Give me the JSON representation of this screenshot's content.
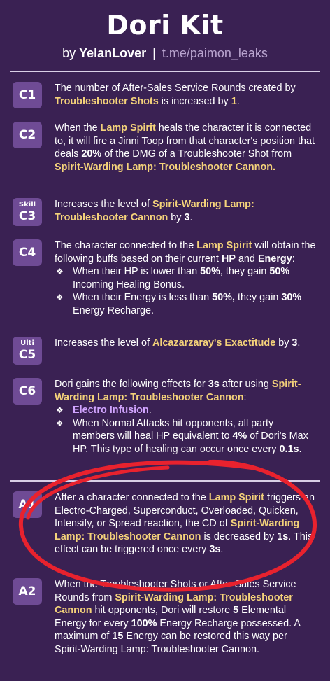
{
  "header": {
    "title": "Dori Kit",
    "by": "by",
    "author": "YelanLover",
    "separator": "|",
    "link": "t.me/paimon_leaks"
  },
  "rows": {
    "c1": {
      "badge": "C1",
      "t1": "The number of After-Sales Service Rounds created by ",
      "h1": "Troubleshooter Shots",
      "t2": " is increased by ",
      "h2": "1",
      "t3": "."
    },
    "c2": {
      "badge": "C2",
      "t1": "When the ",
      "h1": "Lamp Spirit",
      "t2": " heals the character it is connected to, it will fire a Jinni Toop from that character's position that deals ",
      "h2": "20%",
      "t3": " of the DMG of a Troubleshooter Shot from ",
      "h3": "Spirit-Warding Lamp: Troubleshooter Cannon.",
      "t4": ""
    },
    "c3": {
      "badge_small": "Skill",
      "badge": "C3",
      "t1": "Increases the level of ",
      "h1": "Spirit-Warding Lamp: Troubleshooter Cannon",
      "t2": " by ",
      "h2": "3",
      "t3": "."
    },
    "c4": {
      "badge": "C4",
      "t1": "The character connected to the ",
      "h1": "Lamp Spirit",
      "t2": " will obtain the following buffs based on their current ",
      "h2": "HP",
      "t3": " and ",
      "h3": "Energy",
      "t4": ":",
      "b1a": "When their HP is lower than ",
      "b1h": "50%",
      "b1b": ", they gain ",
      "b1h2": "50%",
      "b1c": " Incoming Healing Bonus.",
      "b2a": "When their Energy is less than ",
      "b2h": "50%,",
      "b2b": " they gain ",
      "b2h2": "30%",
      "b2c": " Energy Recharge.",
      "bullet": "❖"
    },
    "c5": {
      "badge_small": "Ulti",
      "badge": "C5",
      "t1": "Increases the level of ",
      "h1": "Alcazarzaray's Exactitude",
      "t2": " by ",
      "h2": "3",
      "t3": "."
    },
    "c6": {
      "badge": "C6",
      "t1": "Dori gains the following effects for ",
      "h1": "3s",
      "t2": " after using ",
      "h2": "Spirit-Warding Lamp: Troubleshooter Cannon",
      "t3": ":",
      "b1": "Electro Infusion",
      "b1end": ".",
      "b2a": "When Normal Attacks hit opponents, all party members will heal HP equivalent to ",
      "b2h": "4%",
      "b2b": " of Dori's Max HP. This type of healing can occur once every ",
      "b2h2": "0.1s",
      "b2c": ".",
      "bullet": "❖"
    },
    "a1": {
      "badge": "A1",
      "t1": "After a character connected to the ",
      "h1": "Lamp Spirit",
      "t2": " triggers an Electro-Charged, Superconduct, Overloaded, Quicken, Intensify, or Spread reaction, the CD of ",
      "h2": "Spirit-Warding Lamp: Troubleshooter Cannon",
      "t3": " is decreased by ",
      "h3": "1s",
      "t4": ". This effect can be triggered once every ",
      "h4": "3s",
      "t5": "."
    },
    "a2": {
      "badge": "A2",
      "t1": "When the Troubleshooter Shots or After-Sales Service Rounds from ",
      "h1": "Spirit-Warding Lamp: Troubleshooter Cannon",
      "t2": " hit opponents, Dori will restore ",
      "h2": "5",
      "t3": " Elemental Energy for every ",
      "h3": "100%",
      "t4": " Energy Recharge possessed. A maximum of ",
      "h4": "15",
      "t5": " Energy can be restored this way per Spirit-Warding Lamp: Troubleshooter Cannon."
    }
  },
  "colors": {
    "background": "#3a2153",
    "badge": "#6f4b95",
    "highlight": "#f4d27a",
    "accent_purple": "#d2a5ff",
    "annotation_red": "#e8222e"
  }
}
